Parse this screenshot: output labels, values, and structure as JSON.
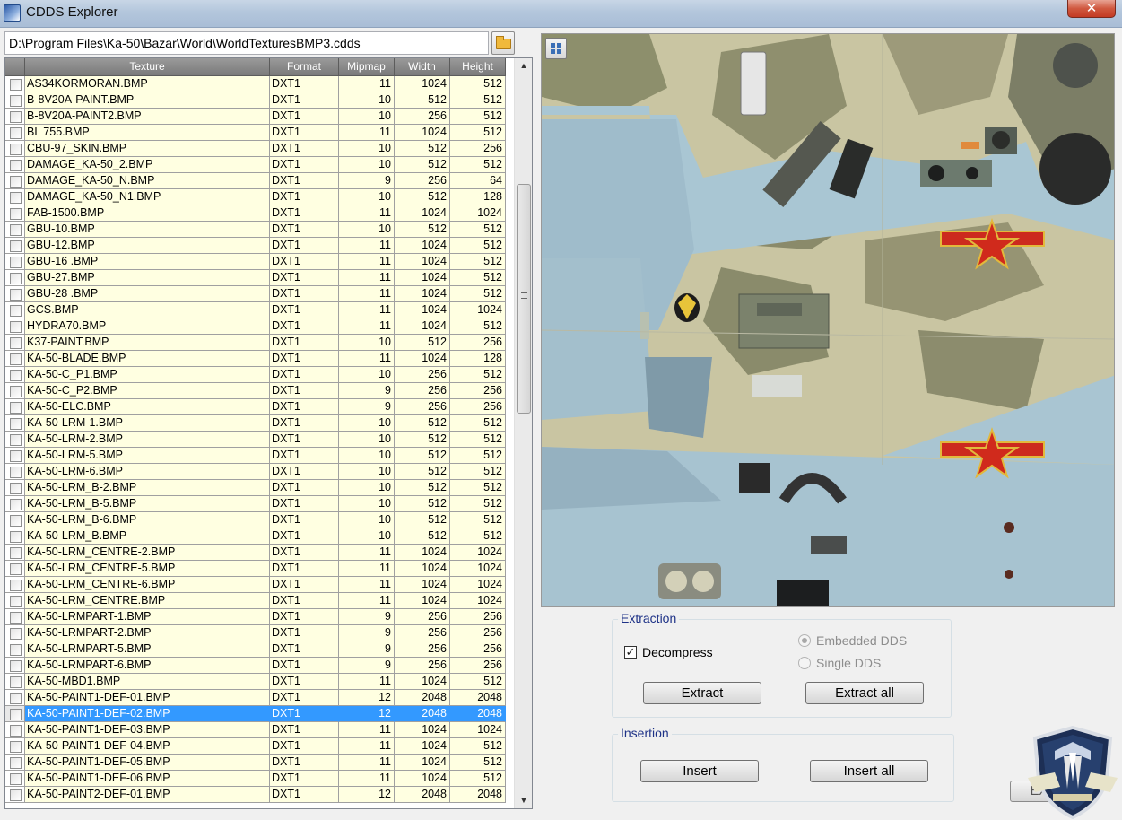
{
  "window": {
    "title": "CDDS Explorer",
    "close_label": "✕"
  },
  "path": {
    "value": "D:\\Program Files\\Ka-50\\Bazar\\World\\WorldTexturesBMP3.cdds"
  },
  "table": {
    "columns": [
      "Texture",
      "Format",
      "Mipmap",
      "Width",
      "Height"
    ],
    "rows": [
      [
        "AS34KORMORAN.BMP",
        "DXT1",
        "11",
        "1024",
        "512"
      ],
      [
        "B-8V20A-PAINT.BMP",
        "DXT1",
        "10",
        "512",
        "512"
      ],
      [
        "B-8V20A-PAINT2.BMP",
        "DXT1",
        "10",
        "256",
        "512"
      ],
      [
        "BL 755.BMP",
        "DXT1",
        "11",
        "1024",
        "512"
      ],
      [
        "CBU-97_SKIN.BMP",
        "DXT1",
        "10",
        "512",
        "256"
      ],
      [
        "DAMAGE_KA-50_2.BMP",
        "DXT1",
        "10",
        "512",
        "512"
      ],
      [
        "DAMAGE_KA-50_N.BMP",
        "DXT1",
        "9",
        "256",
        "64"
      ],
      [
        "DAMAGE_KA-50_N1.BMP",
        "DXT1",
        "10",
        "512",
        "128"
      ],
      [
        "FAB-1500.BMP",
        "DXT1",
        "11",
        "1024",
        "1024"
      ],
      [
        "GBU-10.BMP",
        "DXT1",
        "10",
        "512",
        "512"
      ],
      [
        "GBU-12.BMP",
        "DXT1",
        "11",
        "1024",
        "512"
      ],
      [
        "GBU-16 .BMP",
        "DXT1",
        "11",
        "1024",
        "512"
      ],
      [
        "GBU-27.BMP",
        "DXT1",
        "11",
        "1024",
        "512"
      ],
      [
        "GBU-28 .BMP",
        "DXT1",
        "11",
        "1024",
        "512"
      ],
      [
        "GCS.BMP",
        "DXT1",
        "11",
        "1024",
        "1024"
      ],
      [
        "HYDRA70.BMP",
        "DXT1",
        "11",
        "1024",
        "512"
      ],
      [
        "K37-PAINT.BMP",
        "DXT1",
        "10",
        "512",
        "256"
      ],
      [
        "KA-50-BLADE.BMP",
        "DXT1",
        "11",
        "1024",
        "128"
      ],
      [
        "KA-50-C_P1.BMP",
        "DXT1",
        "10",
        "256",
        "512"
      ],
      [
        "KA-50-C_P2.BMP",
        "DXT1",
        "9",
        "256",
        "256"
      ],
      [
        "KA-50-ELC.BMP",
        "DXT1",
        "9",
        "256",
        "256"
      ],
      [
        "KA-50-LRM-1.BMP",
        "DXT1",
        "10",
        "512",
        "512"
      ],
      [
        "KA-50-LRM-2.BMP",
        "DXT1",
        "10",
        "512",
        "512"
      ],
      [
        "KA-50-LRM-5.BMP",
        "DXT1",
        "10",
        "512",
        "512"
      ],
      [
        "KA-50-LRM-6.BMP",
        "DXT1",
        "10",
        "512",
        "512"
      ],
      [
        "KA-50-LRM_B-2.BMP",
        "DXT1",
        "10",
        "512",
        "512"
      ],
      [
        "KA-50-LRM_B-5.BMP",
        "DXT1",
        "10",
        "512",
        "512"
      ],
      [
        "KA-50-LRM_B-6.BMP",
        "DXT1",
        "10",
        "512",
        "512"
      ],
      [
        "KA-50-LRM_B.BMP",
        "DXT1",
        "10",
        "512",
        "512"
      ],
      [
        "KA-50-LRM_CENTRE-2.BMP",
        "DXT1",
        "11",
        "1024",
        "1024"
      ],
      [
        "KA-50-LRM_CENTRE-5.BMP",
        "DXT1",
        "11",
        "1024",
        "1024"
      ],
      [
        "KA-50-LRM_CENTRE-6.BMP",
        "DXT1",
        "11",
        "1024",
        "1024"
      ],
      [
        "KA-50-LRM_CENTRE.BMP",
        "DXT1",
        "11",
        "1024",
        "1024"
      ],
      [
        "KA-50-LRMPART-1.BMP",
        "DXT1",
        "9",
        "256",
        "256"
      ],
      [
        "KA-50-LRMPART-2.BMP",
        "DXT1",
        "9",
        "256",
        "256"
      ],
      [
        "KA-50-LRMPART-5.BMP",
        "DXT1",
        "9",
        "256",
        "256"
      ],
      [
        "KA-50-LRMPART-6.BMP",
        "DXT1",
        "9",
        "256",
        "256"
      ],
      [
        "KA-50-MBD1.BMP",
        "DXT1",
        "11",
        "1024",
        "512"
      ],
      [
        "KA-50-PAINT1-DEF-01.BMP",
        "DXT1",
        "12",
        "2048",
        "2048"
      ],
      [
        "KA-50-PAINT1-DEF-02.BMP",
        "DXT1",
        "12",
        "2048",
        "2048"
      ],
      [
        "KA-50-PAINT1-DEF-03.BMP",
        "DXT1",
        "11",
        "1024",
        "1024"
      ],
      [
        "KA-50-PAINT1-DEF-04.BMP",
        "DXT1",
        "11",
        "1024",
        "512"
      ],
      [
        "KA-50-PAINT1-DEF-05.BMP",
        "DXT1",
        "11",
        "1024",
        "512"
      ],
      [
        "KA-50-PAINT1-DEF-06.BMP",
        "DXT1",
        "11",
        "1024",
        "512"
      ],
      [
        "KA-50-PAINT2-DEF-01.BMP",
        "DXT1",
        "12",
        "2048",
        "2048"
      ]
    ],
    "selected_texture": "KA-50-PAINT1-DEF-02.BMP"
  },
  "preview": {
    "toggle_icon": "grid-view-icon"
  },
  "extraction": {
    "title": "Extraction",
    "decompress_label": "Decompress",
    "decompress_checked": true,
    "embedded_label": "Embedded DDS",
    "single_label": "Single DDS",
    "extract_label": "Extract",
    "extract_all_label": "Extract all"
  },
  "insertion": {
    "title": "Insertion",
    "insert_label": "Insert",
    "insert_all_label": "Insert all"
  },
  "exit_label": "Exit",
  "colors": {
    "selection": "#3399ff",
    "row_background": "#ffffe1",
    "header_background": "#8a8a8a",
    "group_title": "#1e3287"
  }
}
